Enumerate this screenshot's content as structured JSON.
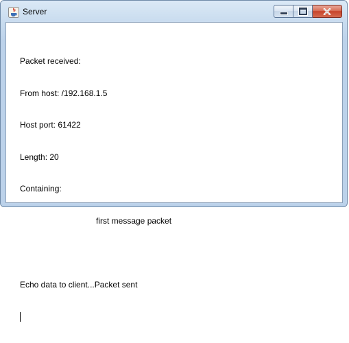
{
  "window": {
    "title": "Server",
    "app_icon": "java-icon"
  },
  "controls": {
    "minimize_icon": "minimize-icon",
    "maximize_icon": "maximize-icon",
    "close_icon": "close-icon"
  },
  "log": {
    "lines": [
      "Packet received:",
      "From host: /192.168.1.5",
      "Host port: 61422",
      "Length: 20",
      "Containing:",
      "first message packet",
      "",
      "Echo data to client...Packet sent"
    ]
  },
  "colors": {
    "titlebar": "#c9dcef",
    "close_button": "#c7442b"
  }
}
